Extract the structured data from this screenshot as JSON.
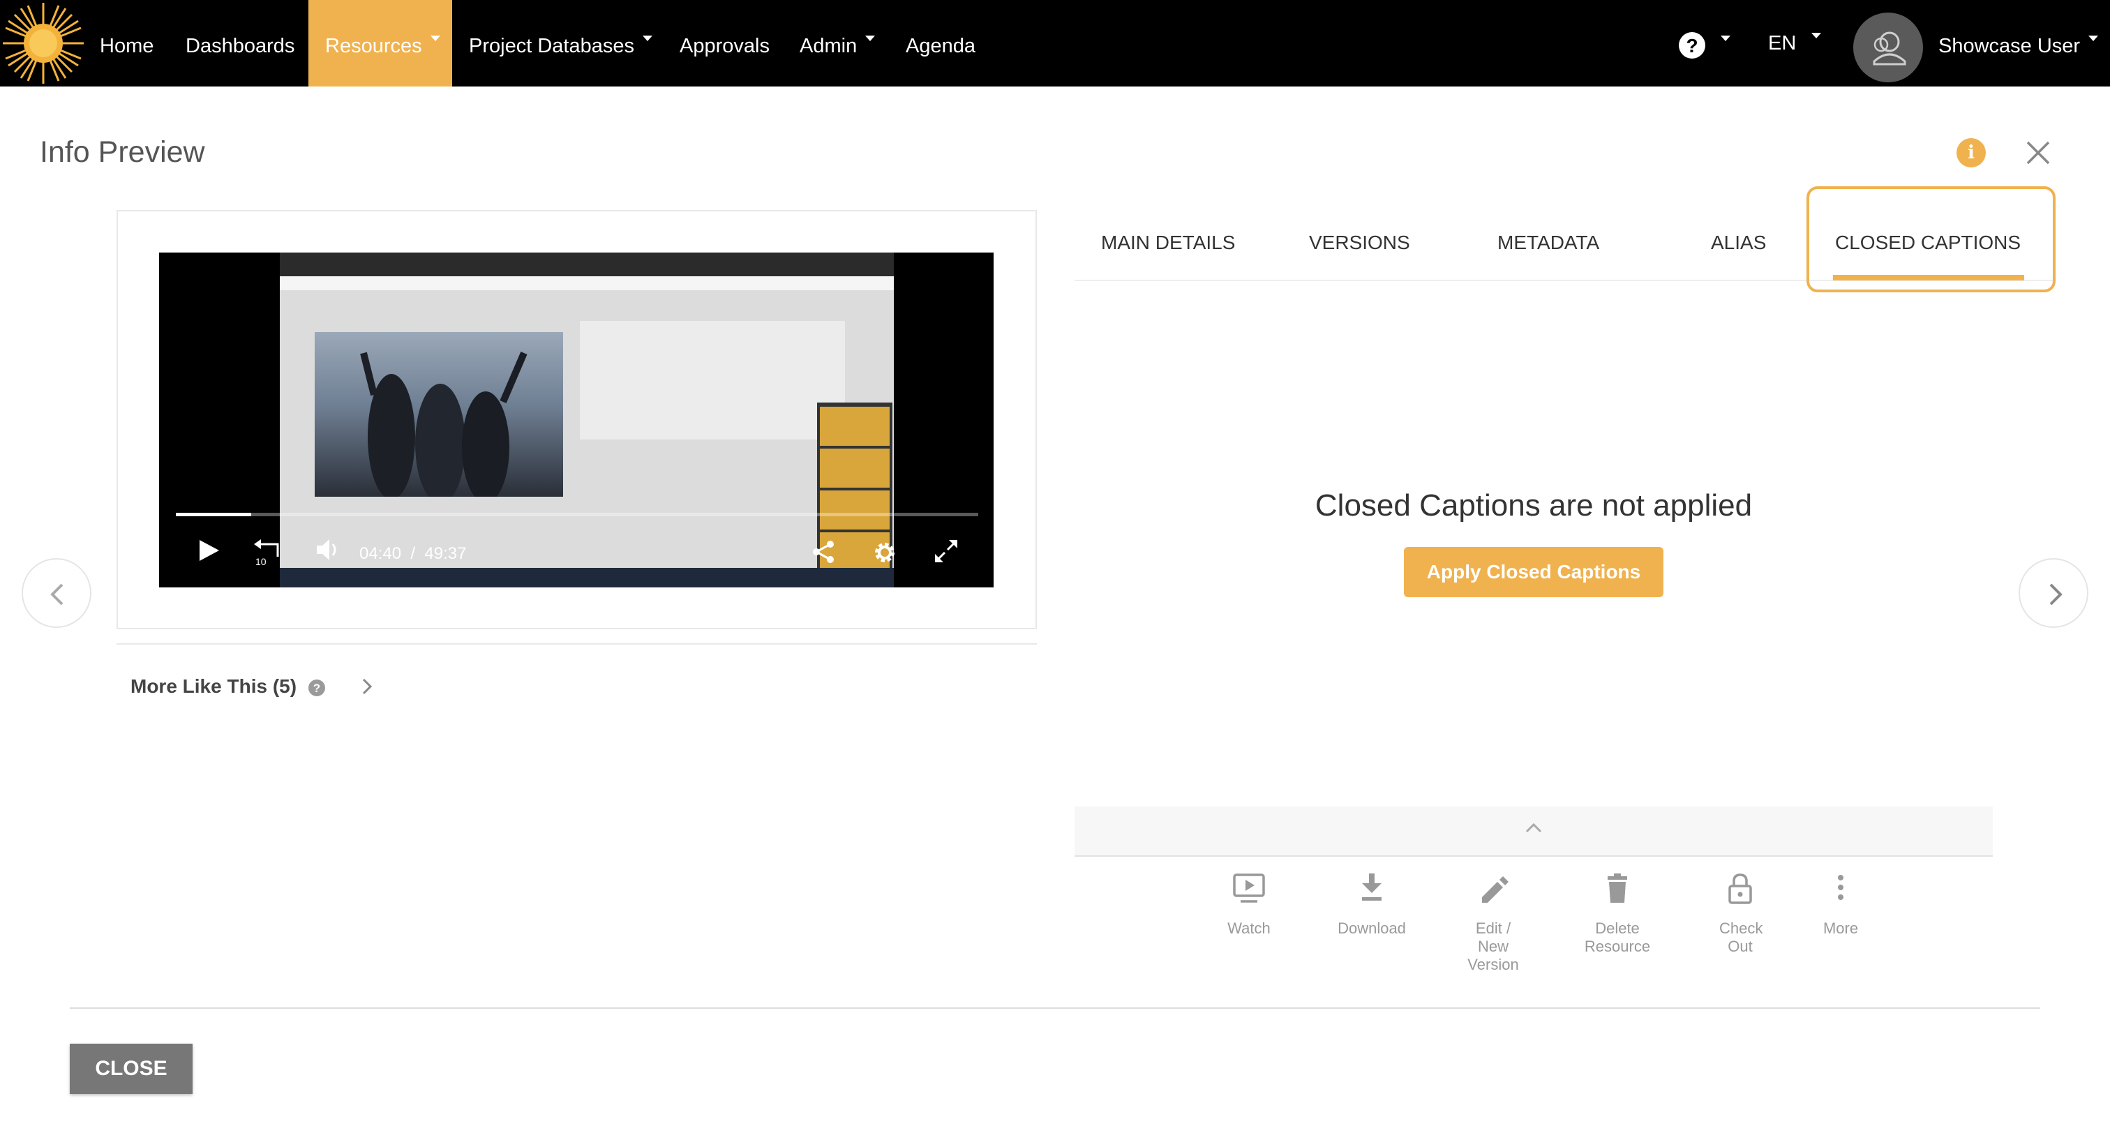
{
  "navbar": {
    "items": [
      {
        "label": "Home"
      },
      {
        "label": "Dashboards"
      },
      {
        "label": "Resources",
        "active": true,
        "dropdown": true
      },
      {
        "label": "Project Databases",
        "dropdown": true
      },
      {
        "label": "Approvals"
      },
      {
        "label": "Admin",
        "dropdown": true
      },
      {
        "label": "Agenda"
      }
    ],
    "help_icon": "question-circle-icon",
    "help_symbol": "?",
    "language": "EN",
    "user_name": "Showcase User",
    "accent_color": "#f0b24e"
  },
  "preview": {
    "title": "Info Preview",
    "info_symbol": "i"
  },
  "video": {
    "current_time": "04:40",
    "separator": "/",
    "duration": "49:37",
    "progress": 0.094
  },
  "tabs": [
    {
      "label": "MAIN DETAILS"
    },
    {
      "label": "VERSIONS"
    },
    {
      "label": "METADATA"
    },
    {
      "label": "ALIAS"
    },
    {
      "label": "CLOSED CAPTIONS",
      "active": true
    }
  ],
  "closed_captions": {
    "message": "Closed Captions are not applied",
    "button_label": "Apply Closed Captions"
  },
  "more_like_this": {
    "label": "More Like This (5)",
    "help_symbol": "?"
  },
  "actions": [
    {
      "label": "Watch",
      "icon": "watch-icon"
    },
    {
      "label": "Download",
      "icon": "download-icon"
    },
    {
      "label": "Edit / New Version",
      "icon": "pencil-icon"
    },
    {
      "label": "Delete Resource",
      "icon": "trash-icon"
    },
    {
      "label": "Check Out",
      "icon": "lock-icon"
    },
    {
      "label": "More",
      "icon": "more-vertical-icon"
    }
  ],
  "footer": {
    "close_label": "CLOSE"
  }
}
